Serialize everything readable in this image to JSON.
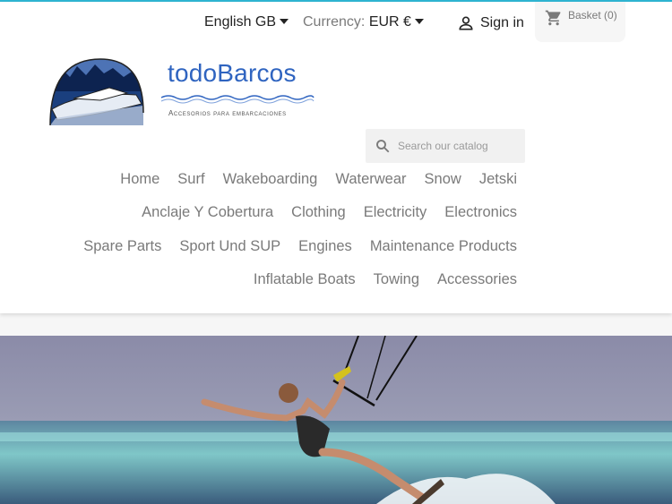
{
  "header": {
    "language": "English GB",
    "currency_label": "Currency:",
    "currency_value": "EUR €",
    "signin_label": "Sign in",
    "basket_label": "Basket (0)"
  },
  "logo": {
    "title": "todoBarcos",
    "subtitle": "Accesorios para embarcaciones"
  },
  "search": {
    "placeholder": "Search our catalog"
  },
  "menu": {
    "row1": [
      "Home",
      "Surf",
      "Wakeboarding",
      "Waterwear",
      "Snow",
      "Jetski"
    ],
    "row2": [
      "Anclaje Y Cobertura",
      "Clothing",
      "Electricity",
      "Electronics"
    ],
    "row3": [
      "Spare Parts",
      "Sport Und SUP",
      "Engines",
      "Maintenance Products"
    ],
    "row4": [
      "Inflatable Boats",
      "Towing",
      "Accessories"
    ]
  },
  "colors": {
    "accent": "#2fb5d2",
    "logo_blue": "#2f64c0",
    "text": "#7a7a7a",
    "dark": "#232323"
  }
}
